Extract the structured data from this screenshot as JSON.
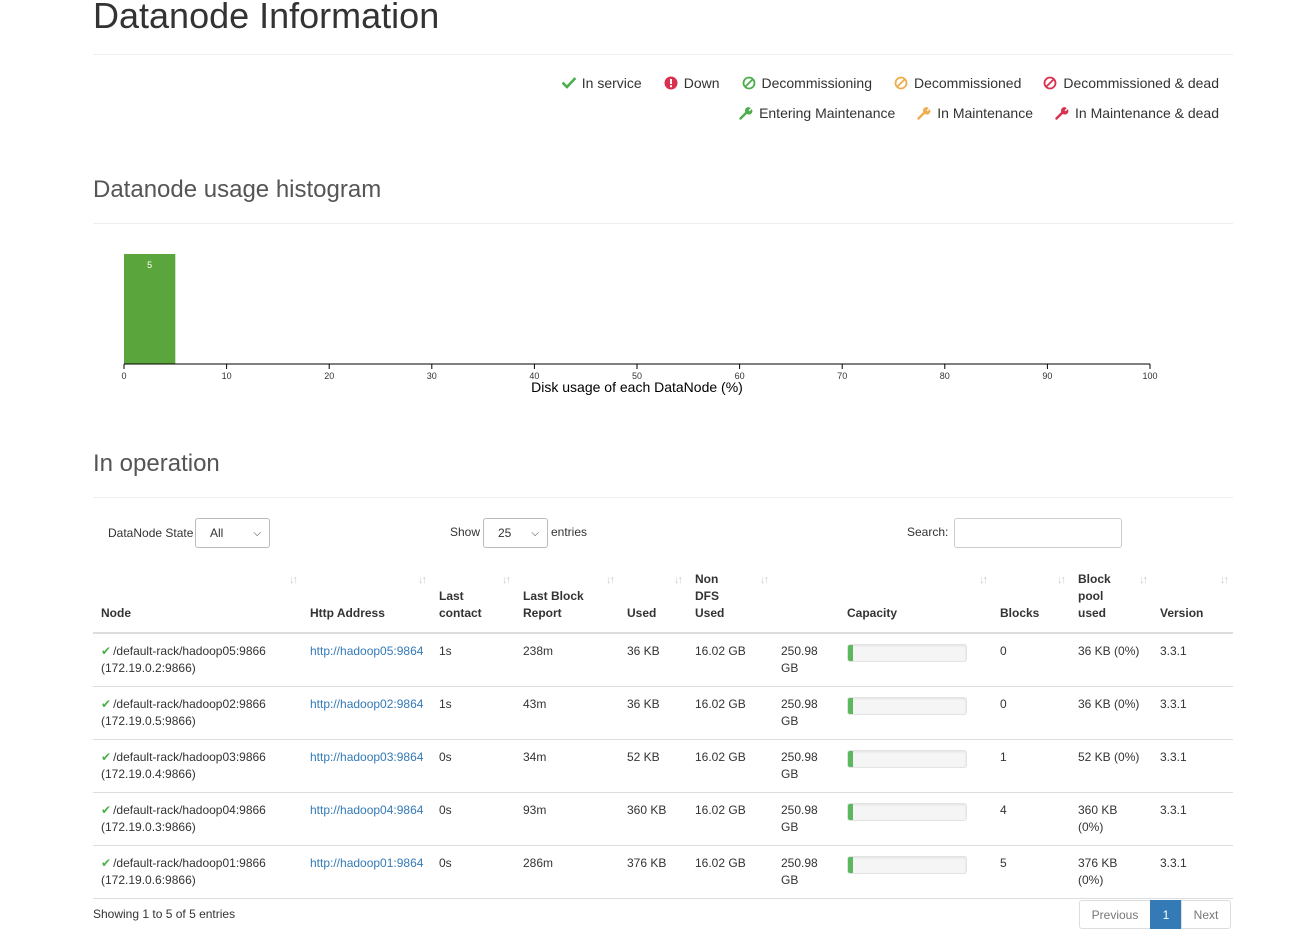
{
  "page": {
    "title": "Datanode Information"
  },
  "legend": {
    "row1": [
      {
        "label": "In service",
        "icon": "check-icon",
        "color": "#4cae4c"
      },
      {
        "label": "Down",
        "icon": "exclamation-circle-icon",
        "color": "#d9304f"
      },
      {
        "label": "Decommissioning",
        "icon": "ban-icon",
        "color": "#4cae4c"
      },
      {
        "label": "Decommissioned",
        "icon": "ban-icon",
        "color": "#f0ad4e"
      },
      {
        "label": "Decommissioned & dead",
        "icon": "ban-icon",
        "color": "#d9304f"
      }
    ],
    "row2": [
      {
        "label": "Entering Maintenance",
        "icon": "wrench-icon",
        "color": "#4cae4c"
      },
      {
        "label": "In Maintenance",
        "icon": "wrench-icon",
        "color": "#f0ad4e"
      },
      {
        "label": "In Maintenance & dead",
        "icon": "wrench-icon",
        "color": "#d9304f"
      }
    ]
  },
  "histogram": {
    "title": "Datanode usage histogram"
  },
  "chart_data": {
    "type": "bar",
    "bins": [
      [
        0,
        5
      ]
    ],
    "values": [
      5
    ],
    "xlabel": "Disk usage of each DataNode (%)",
    "xlim": [
      0,
      100
    ],
    "xticks": [
      0,
      10,
      20,
      30,
      40,
      50,
      60,
      70,
      80,
      90,
      100
    ],
    "bar_color": "#5aa53c"
  },
  "operation": {
    "title": "In operation",
    "state_label": "DataNode State",
    "state_value": "All",
    "show_label": "Show",
    "show_value": "25",
    "entries_label": "entries",
    "search_label": "Search:"
  },
  "table": {
    "headers": {
      "node": "Node",
      "http": "Http Address",
      "last_contact_1": "Last",
      "last_contact_2": "contact",
      "last_block_1": "Last Block",
      "last_block_2": "Report",
      "used": "Used",
      "nondfs_1": "Non",
      "nondfs_2": "DFS",
      "nondfs_3": "Used",
      "capacity": "Capacity",
      "blocks": "Blocks",
      "bp_1": "Block",
      "bp_2": "pool",
      "bp_3": "used",
      "version": "Version"
    },
    "rows": [
      {
        "node": "/default-rack/hadoop05:9866",
        "ip": "(172.19.0.2:9866)",
        "http": "http://hadoop05:9864",
        "last_contact": "1s",
        "last_block": "238m",
        "used": "36 KB",
        "non_dfs": "16.02 GB",
        "capacity": "250.98 GB",
        "capacity_pct": 4,
        "blocks": "0",
        "bp_used": "36 KB (0%)",
        "version": "3.3.1"
      },
      {
        "node": "/default-rack/hadoop02:9866",
        "ip": "(172.19.0.5:9866)",
        "http": "http://hadoop02:9864",
        "last_contact": "1s",
        "last_block": "43m",
        "used": "36 KB",
        "non_dfs": "16.02 GB",
        "capacity": "250.98 GB",
        "capacity_pct": 4,
        "blocks": "0",
        "bp_used": "36 KB (0%)",
        "version": "3.3.1"
      },
      {
        "node": "/default-rack/hadoop03:9866",
        "ip": "(172.19.0.4:9866)",
        "http": "http://hadoop03:9864",
        "last_contact": "0s",
        "last_block": "34m",
        "used": "52 KB",
        "non_dfs": "16.02 GB",
        "capacity": "250.98 GB",
        "capacity_pct": 4,
        "blocks": "1",
        "bp_used": "52 KB (0%)",
        "version": "3.3.1"
      },
      {
        "node": "/default-rack/hadoop04:9866",
        "ip": "(172.19.0.3:9866)",
        "http": "http://hadoop04:9864",
        "last_contact": "0s",
        "last_block": "93m",
        "used": "360 KB",
        "non_dfs": "16.02 GB",
        "capacity": "250.98 GB",
        "capacity_pct": 4,
        "blocks": "4",
        "bp_used": "360 KB (0%)",
        "version": "3.3.1"
      },
      {
        "node": "/default-rack/hadoop01:9866",
        "ip": "(172.19.0.6:9866)",
        "http": "http://hadoop01:9864",
        "last_contact": "0s",
        "last_block": "286m",
        "used": "376 KB",
        "non_dfs": "16.02 GB",
        "capacity": "250.98 GB",
        "capacity_pct": 4,
        "blocks": "5",
        "bp_used": "376 KB (0%)",
        "version": "3.3.1"
      }
    ]
  },
  "footer": {
    "info": "Showing 1 to 5 of 5 entries",
    "prev": "Previous",
    "page": "1",
    "next": "Next"
  }
}
